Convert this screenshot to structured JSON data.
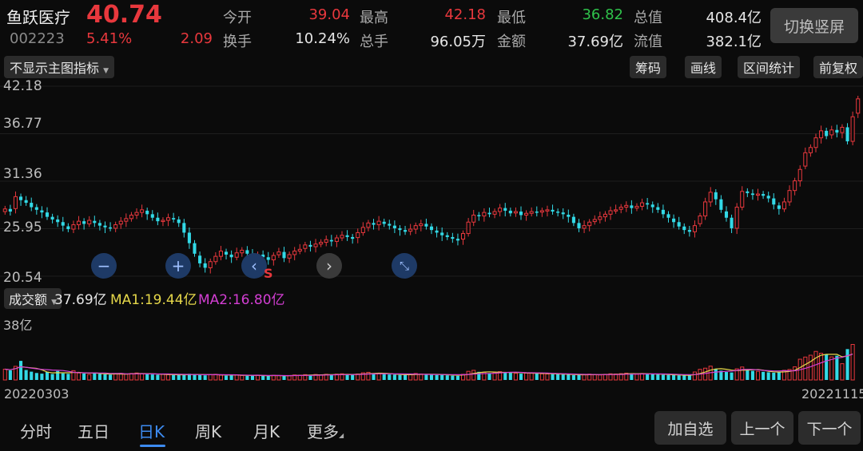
{
  "stock": {
    "name": "鱼跃医疗",
    "price": "40.74",
    "code": "002223",
    "change_pct": "5.41%",
    "change": "2.09"
  },
  "stats": {
    "open_label": "今开",
    "open": "39.04",
    "high_label": "最高",
    "high": "42.18",
    "low_label": "最低",
    "low": "36.82",
    "mcap_label": "总值",
    "mcap": "408.4亿",
    "turnover_label": "换手",
    "turnover": "10.24%",
    "volume_label": "总手",
    "volume": "96.05万",
    "amount_label": "金额",
    "amount": "37.69亿",
    "float_label": "流值",
    "float_cap": "382.1亿"
  },
  "switch_button": "切换竖屏",
  "toolbar": {
    "indicator_select": "不显示主图指标",
    "chips_button": "筹码",
    "draw_button": "画线",
    "interval_button": "区间统计",
    "adjust_button": "前复权"
  },
  "price_axis": [
    "42.18",
    "36.77",
    "31.36",
    "25.95",
    "20.54"
  ],
  "signal_mark": "S",
  "volume_panel": {
    "select_label": "成交额",
    "current": "37.69亿",
    "ma1": "MA1:19.44亿",
    "ma2": "MA2:16.80亿",
    "axis_top": "38亿"
  },
  "dates": {
    "start": "20220303",
    "end": "20221115"
  },
  "tabs": [
    "分时",
    "五日",
    "日K",
    "周K",
    "月K",
    "更多"
  ],
  "active_tab": "日K",
  "bottom_buttons": {
    "add_watch": "加自选",
    "prev": "上一个",
    "next": "下一个"
  },
  "colors": {
    "up": "#e8383d",
    "down": "#32d9e6",
    "ma1": "#e6d84a",
    "ma2": "#d33ed3",
    "active_tab": "#3d8bf0"
  },
  "chart_data": {
    "type": "candlestick",
    "y_range": [
      20.54,
      42.18
    ],
    "closes": [
      28.2,
      27.9,
      29.6,
      29.2,
      28.9,
      28.4,
      28.1,
      27.8,
      27.3,
      27.0,
      26.7,
      26.3,
      25.9,
      26.4,
      26.8,
      26.5,
      26.9,
      26.6,
      26.3,
      26.1,
      26.0,
      26.4,
      26.8,
      27.1,
      27.5,
      27.8,
      28.1,
      27.6,
      27.2,
      26.8,
      26.9,
      27.2,
      27.0,
      26.6,
      25.5,
      24.3,
      23.1,
      22.0,
      21.5,
      22.2,
      22.8,
      23.4,
      23.0,
      22.7,
      23.2,
      23.5,
      23.1,
      22.8,
      23.0,
      22.7,
      22.4,
      22.9,
      23.3,
      22.6,
      23.0,
      23.4,
      23.6,
      24.1,
      23.9,
      24.2,
      24.4,
      24.7,
      24.5,
      24.9,
      25.2,
      25.0,
      24.8,
      25.5,
      26.1,
      26.6,
      26.4,
      26.8,
      26.5,
      26.3,
      26.0,
      25.8,
      25.6,
      25.9,
      26.3,
      26.5,
      26.2,
      25.8,
      25.5,
      25.2,
      25.0,
      24.8,
      24.6,
      25.4,
      26.7,
      27.5,
      27.4,
      27.8,
      27.6,
      27.9,
      28.3,
      28.0,
      27.7,
      27.9,
      27.5,
      27.7,
      27.9,
      27.8,
      28.0,
      28.1,
      27.9,
      27.8,
      27.6,
      27.3,
      26.6,
      26.0,
      26.3,
      26.7,
      27.0,
      27.3,
      27.6,
      28.0,
      28.1,
      28.4,
      28.6,
      28.3,
      28.5,
      28.9,
      28.7,
      28.4,
      28.1,
      27.6,
      27.2,
      26.7,
      26.2,
      25.8,
      25.6,
      26.3,
      27.4,
      29.0,
      30.1,
      29.3,
      28.1,
      27.2,
      26.0,
      28.4,
      30.2,
      30.0,
      29.8,
      29.9,
      29.7,
      29.4,
      28.7,
      28.2,
      29.0,
      30.3,
      31.4,
      32.7,
      34.6,
      35.2,
      36.3,
      37.1,
      36.5,
      37.2,
      36.9,
      37.5,
      35.9,
      38.7,
      40.74
    ],
    "volumes": [
      6.5,
      5.8,
      8.2,
      11.5,
      6.0,
      5.0,
      4.2,
      3.8,
      4.9,
      3.6,
      5.4,
      4.0,
      3.7,
      5.6,
      4.2,
      3.9,
      3.3,
      4.4,
      3.6,
      3.4,
      3.2,
      3.6,
      4.0,
      3.5,
      3.9,
      4.2,
      3.7,
      3.6,
      3.3,
      3.1,
      3.4,
      3.2,
      3.0,
      2.9,
      3.2,
      3.7,
      3.5,
      3.0,
      2.8,
      3.2,
      3.4,
      2.9,
      2.6,
      2.8,
      3.1,
      2.7,
      2.5,
      2.6,
      2.9,
      2.5,
      2.4,
      2.8,
      2.6,
      2.5,
      2.7,
      3.0,
      2.9,
      3.2,
      3.0,
      3.3,
      3.1,
      3.4,
      3.0,
      3.5,
      3.7,
      3.2,
      3.1,
      3.6,
      4.3,
      4.6,
      4.1,
      3.8,
      3.5,
      3.3,
      3.2,
      3.0,
      2.9,
      3.4,
      3.9,
      3.6,
      3.3,
      3.1,
      3.0,
      3.5,
      2.8,
      2.6,
      2.5,
      3.4,
      5.2,
      5.8,
      4.9,
      4.6,
      4.1,
      4.5,
      5.0,
      4.7,
      4.3,
      4.0,
      3.8,
      4.1,
      4.2,
      3.9,
      3.7,
      3.6,
      3.5,
      3.4,
      3.3,
      3.2,
      2.9,
      3.0,
      3.3,
      3.5,
      3.2,
      3.0,
      3.4,
      3.7,
      3.6,
      3.8,
      4.1,
      3.7,
      3.5,
      3.9,
      3.6,
      3.4,
      3.3,
      3.1,
      3.0,
      2.9,
      2.8,
      2.7,
      2.9,
      4.8,
      6.4,
      7.1,
      8.3,
      6.5,
      5.6,
      4.8,
      4.5,
      6.7,
      7.8,
      6.1,
      5.5,
      5.2,
      4.9,
      4.6,
      4.4,
      4.7,
      5.8,
      6.3,
      7.9,
      12.5,
      13.8,
      14.9,
      17.2,
      16.1,
      15.3,
      13.9,
      14.6,
      9.8,
      18.6,
      21.4
    ]
  }
}
